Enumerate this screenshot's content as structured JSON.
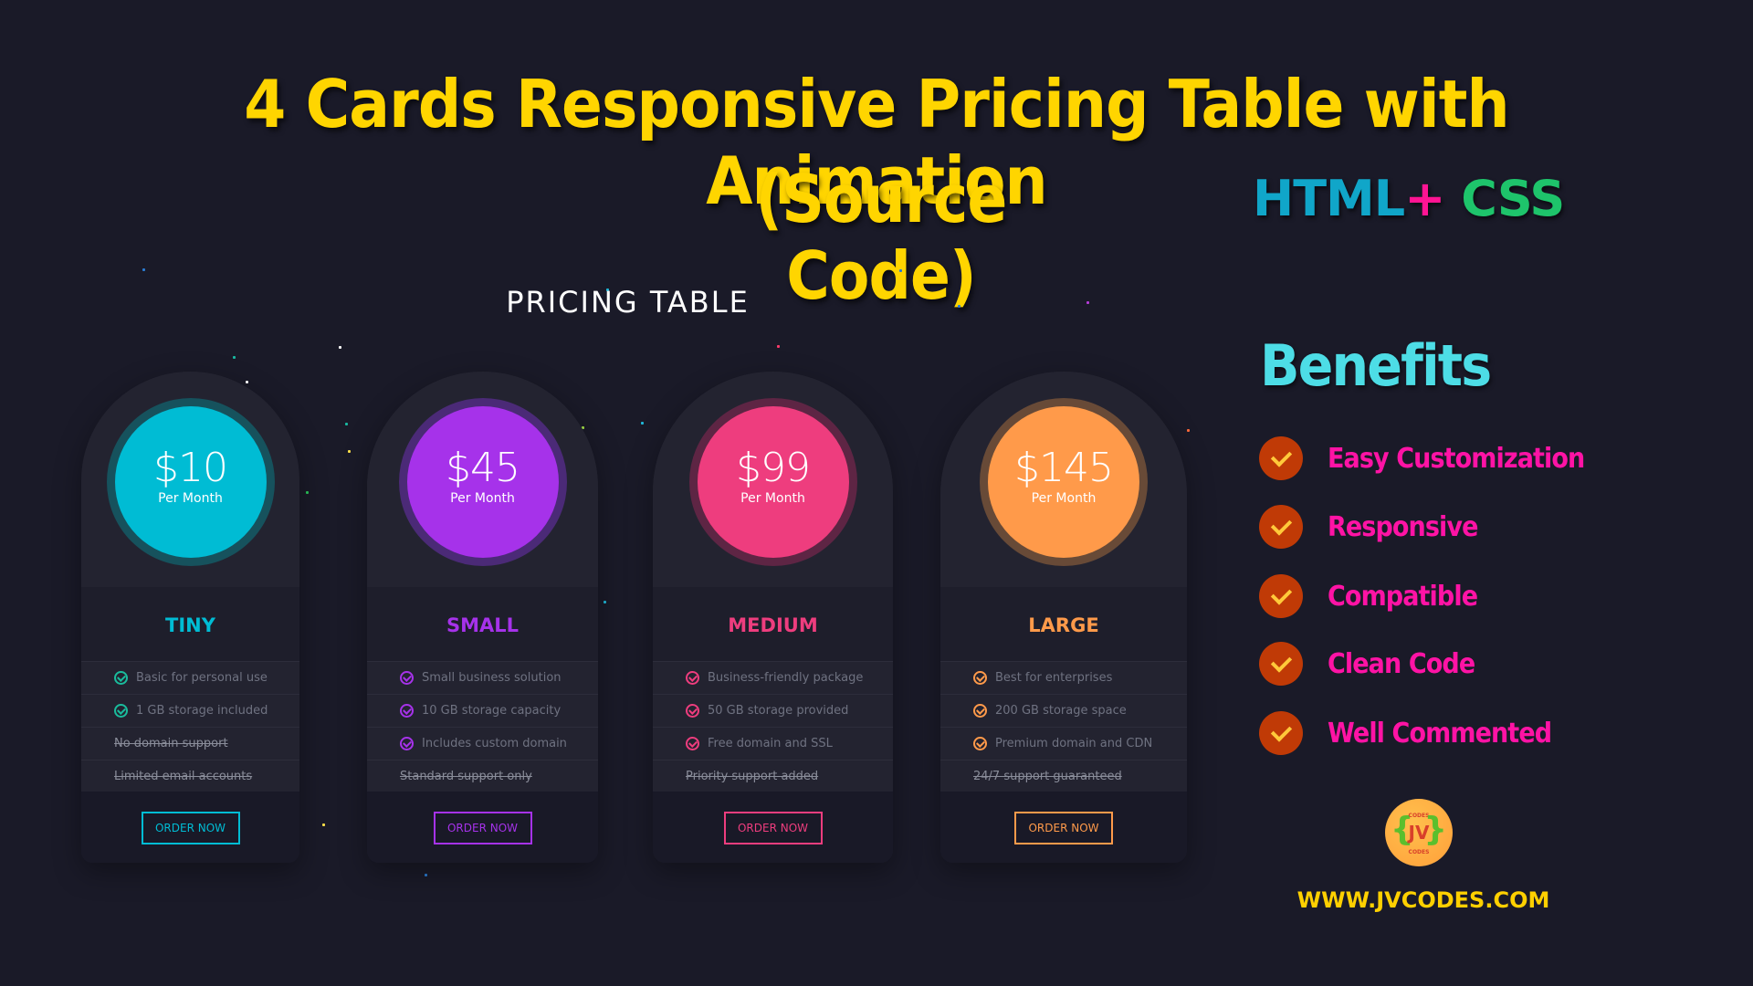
{
  "headline": {
    "line1": "4 Cards Responsive Pricing Table with Animation",
    "line2": "(Source Code)"
  },
  "tech": {
    "html": "HTML",
    "plus": "+",
    "css": "CSS"
  },
  "colors": {
    "background": "#1a1a28",
    "headline": "#ffd500",
    "benefits_title": "#4ddde6",
    "benefit_text": "#ff13a5",
    "benefit_check_bg": "#c03a06",
    "benefit_check_mark": "#ffc93a",
    "website": "#ffd000"
  },
  "pricing": {
    "title": "PRICING TABLE",
    "cards": [
      {
        "price": "$10",
        "period": "Per Month",
        "name": "TINY",
        "accent": "#00bcd4",
        "ring": "#16525d",
        "check": "#1abc9c",
        "button_color": "#00bcd4",
        "features": [
          {
            "text": "Basic for personal use",
            "included": true
          },
          {
            "text": "1 GB storage included",
            "included": true
          },
          {
            "text": "No domain support",
            "included": false
          },
          {
            "text": "Limited email accounts",
            "included": false
          }
        ],
        "button": "ORDER NOW"
      },
      {
        "price": "$45",
        "period": "Per Month",
        "name": "SMALL",
        "accent": "#a632ea",
        "ring": "#4b2a77",
        "check": "#a632ea",
        "button_color": "#a632ea",
        "features": [
          {
            "text": "Small business solution",
            "included": true
          },
          {
            "text": "10 GB storage capacity",
            "included": true
          },
          {
            "text": "Includes custom domain",
            "included": true
          },
          {
            "text": "Standard support only",
            "included": false
          }
        ],
        "button": "ORDER NOW"
      },
      {
        "price": "$99",
        "period": "Per Month",
        "name": "MEDIUM",
        "accent": "#ee3d7e",
        "ring": "#5e2544",
        "check": "#ee3d7e",
        "button_color": "#ee3d7e",
        "features": [
          {
            "text": "Business-friendly package",
            "included": true
          },
          {
            "text": "50 GB storage provided",
            "included": true
          },
          {
            "text": "Free domain and SSL",
            "included": true
          },
          {
            "text": "Priority support added",
            "included": false
          }
        ],
        "button": "ORDER NOW"
      },
      {
        "price": "$145",
        "period": "Per Month",
        "name": "LARGE",
        "accent": "#ff9a4a",
        "ring": "#684a37",
        "check": "#ff9a4a",
        "button_color": "#ff9a4a",
        "features": [
          {
            "text": "Best for enterprises",
            "included": true
          },
          {
            "text": "200 GB storage space",
            "included": true
          },
          {
            "text": "Premium domain and CDN",
            "included": true
          },
          {
            "text": "24/7 support guaranteed",
            "included": false
          }
        ],
        "button": "ORDER NOW"
      }
    ]
  },
  "benefits": {
    "title": "Benefits",
    "items": [
      {
        "label": "Easy Customization",
        "icon": "check-icon"
      },
      {
        "label": "Responsive",
        "icon": "check-icon"
      },
      {
        "label": "Compatible",
        "icon": "check-icon"
      },
      {
        "label": "Clean Code",
        "icon": "check-icon"
      },
      {
        "label": "Well Commented",
        "icon": "check-icon"
      }
    ]
  },
  "logo": {
    "top_text": "CODES",
    "mark": "JV",
    "bottom_text": "CODES",
    "brace_left": "{",
    "brace_right": "}"
  },
  "website": "WWW.JVCODES.COM"
}
